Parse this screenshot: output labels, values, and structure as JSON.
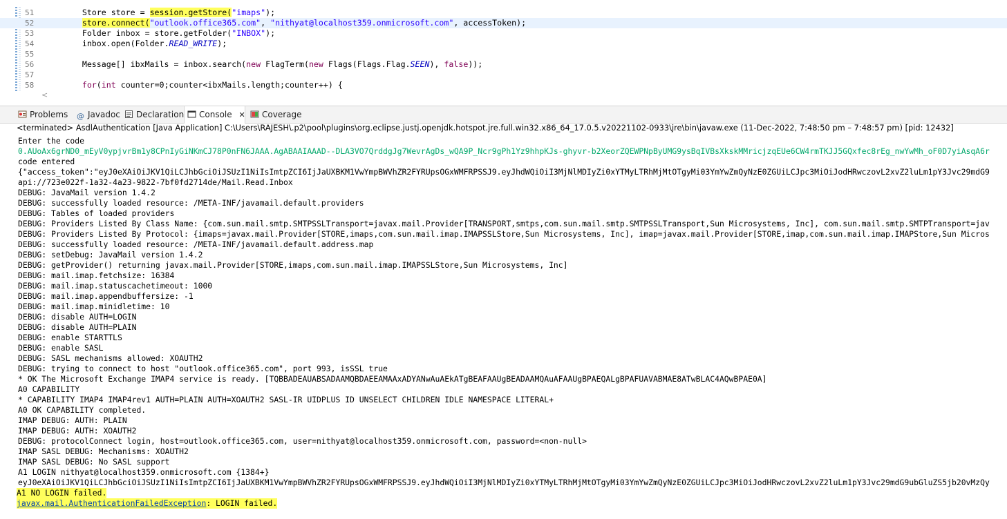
{
  "editor": {
    "lines": [
      {
        "num": "51",
        "segs": [
          {
            "t": "        Store store = "
          },
          {
            "t": "session.getStore(",
            "cls": "hl"
          },
          {
            "t": "\"imaps\"",
            "cls": "str"
          },
          {
            "t": ");"
          }
        ]
      },
      {
        "num": "52",
        "current": true,
        "segs": [
          {
            "t": "        "
          },
          {
            "t": "store.connect(",
            "cls": "hl"
          },
          {
            "t": "\"outlook.office365.com\"",
            "cls": "str"
          },
          {
            "t": ", "
          },
          {
            "t": "\"nithyat@localhost359.onmicrosoft.com\"",
            "cls": "str"
          },
          {
            "t": ", accessToken);"
          }
        ]
      },
      {
        "num": "53",
        "segs": [
          {
            "t": "        Folder inbox = store.getFolder("
          },
          {
            "t": "\"INBOX\"",
            "cls": "str"
          },
          {
            "t": ");"
          }
        ]
      },
      {
        "num": "54",
        "segs": [
          {
            "t": "        inbox.open(Folder."
          },
          {
            "t": "READ_WRITE",
            "cls": "fld"
          },
          {
            "t": ");"
          }
        ]
      },
      {
        "num": "55",
        "segs": [
          {
            "t": ""
          }
        ]
      },
      {
        "num": "56",
        "segs": [
          {
            "t": "        Message[] ibxMails = inbox.search("
          },
          {
            "t": "new",
            "cls": "kw"
          },
          {
            "t": " FlagTerm("
          },
          {
            "t": "new",
            "cls": "kw"
          },
          {
            "t": " Flags(Flags.Flag."
          },
          {
            "t": "SEEN",
            "cls": "fld"
          },
          {
            "t": "), "
          },
          {
            "t": "false",
            "cls": "kw"
          },
          {
            "t": "));"
          }
        ]
      },
      {
        "num": "57",
        "segs": [
          {
            "t": ""
          }
        ]
      },
      {
        "num": "58",
        "segs": [
          {
            "t": "        "
          },
          {
            "t": "for",
            "cls": "kw"
          },
          {
            "t": "("
          },
          {
            "t": "int",
            "cls": "kw"
          },
          {
            "t": " counter=0;counter<ibxMails.length;counter++) {"
          }
        ]
      }
    ],
    "scroll_arrow": "<"
  },
  "tabs": [
    {
      "label": "Problems",
      "icon": "problems-icon"
    },
    {
      "label": "Javadoc",
      "icon": "javadoc-icon"
    },
    {
      "label": "Declaration",
      "icon": "declaration-icon"
    },
    {
      "label": "Console",
      "icon": "console-icon",
      "active": true,
      "close": "✕"
    },
    {
      "label": "Coverage",
      "icon": "coverage-icon"
    }
  ],
  "status_line": "<terminated> AsdlAuthentication [Java Application] C:\\Users\\RAJESH\\.p2\\pool\\plugins\\org.eclipse.justj.openjdk.hotspot.jre.full.win32.x86_64_17.0.5.v20221102-0933\\jre\\bin\\javaw.exe  (11-Dec-2022, 7:48:50 pm – 7:48:57 pm) [pid: 12432]",
  "console": {
    "lines": [
      {
        "text": "Enter the code"
      },
      {
        "text": "0.AUoAx6grND0_mEyV0ypjvrBm1y8CPnIyGiNKmCJ78P0nFN6JAAA.AgABAAIAAAD--DLA3VO7QrddgJg7WevrAgDs_wQA9P_Ncr9gPh1Yz9hhpKJs-ghyvr-b2XeorZQEWPNpByUMG9ysBqIVBsXkskMMricjzqEUe6CW4rmTKJJ5GQxfec8rEg_nwYwMh_oF0D7yiAsqA6r",
        "style": "green"
      },
      {
        "text": "code entered"
      },
      {
        "text": "{\"access_token\":\"eyJ0eXAiOiJKV1QiLCJhbGciOiJSUzI1NiIsImtpZCI6IjJaUXBKM1VwYmpBWVhZR2FYRUpsOGxWMFRPSSJ9.eyJhdWQiOiI3MjNlMDIyZi0xYTMyLTRhMjMtOTgyMi03YmYwZmQyNzE0ZGUiLCJpc3MiOiJodHRwczovL2xvZ2luLm1pY3Jvc29mdG9"
      },
      {
        "text": "api://723e022f-1a32-4a23-9822-7bf0fd2714de/Mail.Read.Inbox"
      },
      {
        "text": "DEBUG: JavaMail version 1.4.2"
      },
      {
        "text": "DEBUG: successfully loaded resource: /META-INF/javamail.default.providers"
      },
      {
        "text": "DEBUG: Tables of loaded providers"
      },
      {
        "text": "DEBUG: Providers Listed By Class Name: {com.sun.mail.smtp.SMTPSSLTransport=javax.mail.Provider[TRANSPORT,smtps,com.sun.mail.smtp.SMTPSSLTransport,Sun Microsystems, Inc], com.sun.mail.smtp.SMTPTransport=jav"
      },
      {
        "text": "DEBUG: Providers Listed By Protocol: {imaps=javax.mail.Provider[STORE,imaps,com.sun.mail.imap.IMAPSSLStore,Sun Microsystems, Inc], imap=javax.mail.Provider[STORE,imap,com.sun.mail.imap.IMAPStore,Sun Micros"
      },
      {
        "text": "DEBUG: successfully loaded resource: /META-INF/javamail.default.address.map"
      },
      {
        "text": "DEBUG: setDebug: JavaMail version 1.4.2"
      },
      {
        "text": "DEBUG: getProvider() returning javax.mail.Provider[STORE,imaps,com.sun.mail.imap.IMAPSSLStore,Sun Microsystems, Inc]"
      },
      {
        "text": "DEBUG: mail.imap.fetchsize: 16384"
      },
      {
        "text": "DEBUG: mail.imap.statuscachetimeout: 1000"
      },
      {
        "text": "DEBUG: mail.imap.appendbuffersize: -1"
      },
      {
        "text": "DEBUG: mail.imap.minidletime: 10"
      },
      {
        "text": "DEBUG: disable AUTH=LOGIN"
      },
      {
        "text": "DEBUG: disable AUTH=PLAIN"
      },
      {
        "text": "DEBUG: enable STARTTLS"
      },
      {
        "text": "DEBUG: enable SASL"
      },
      {
        "text": "DEBUG: SASL mechanisms allowed: XOAUTH2"
      },
      {
        "text": "DEBUG: trying to connect to host \"outlook.office365.com\", port 993, isSSL true"
      },
      {
        "text": "* OK The Microsoft Exchange IMAP4 service is ready. [TQBBADEAUABSADAAMQBDAEEAMAAxADYANwAuAEkATgBEAFAAUgBEADAAMQAuAFAAUgBPAEQALgBPAFUAVABMAE8ATwBLAC4AQwBPAE0A]"
      },
      {
        "text": "A0 CAPABILITY"
      },
      {
        "text": "* CAPABILITY IMAP4 IMAP4rev1 AUTH=PLAIN AUTH=XOAUTH2 SASL-IR UIDPLUS ID UNSELECT CHILDREN IDLE NAMESPACE LITERAL+"
      },
      {
        "text": "A0 OK CAPABILITY completed."
      },
      {
        "text": "IMAP DEBUG: AUTH: PLAIN"
      },
      {
        "text": "IMAP DEBUG: AUTH: XOAUTH2"
      },
      {
        "text": "DEBUG: protocolConnect login, host=outlook.office365.com, user=nithyat@localhost359.onmicrosoft.com, password=<non-null>"
      },
      {
        "text": "IMAP SASL DEBUG: Mechanisms: XOAUTH2"
      },
      {
        "text": "IMAP SASL DEBUG: No SASL support"
      },
      {
        "text": "A1 LOGIN nithyat@localhost359.onmicrosoft.com {1384+}"
      },
      {
        "text": "eyJ0eXAiOiJKV1QiLCJhbGciOiJSUzI1NiIsImtpZCI6IjJaUXBKM1VwYmpBWVhZR2FYRUpsOGxWMFRPSSJ9.eyJhdWQiOiI3MjNlMDIyZi0xYTMyLTRhMjMtOTgyMi03YmYwZmQyNzE0ZGUiLCJpc3MiOiJodHRwczovL2xvZ2luLm1pY3Jvc29mdG9ubGluZS5jb20vMzQy"
      },
      {
        "text": "A1 NO LOGIN failed.",
        "style": "hl"
      },
      {
        "link": "javax.mail.AuthenticationFailedException",
        "rest": ": LOGIN failed.",
        "style": "hl"
      }
    ]
  },
  "colors": {
    "highlight": "#ffff5c",
    "string": "#2a00ff",
    "keyword": "#7f0055",
    "field": "#0000c0",
    "green_output": "#00a86b",
    "link": "#0645ad",
    "current_line": "#e8f2fe"
  }
}
